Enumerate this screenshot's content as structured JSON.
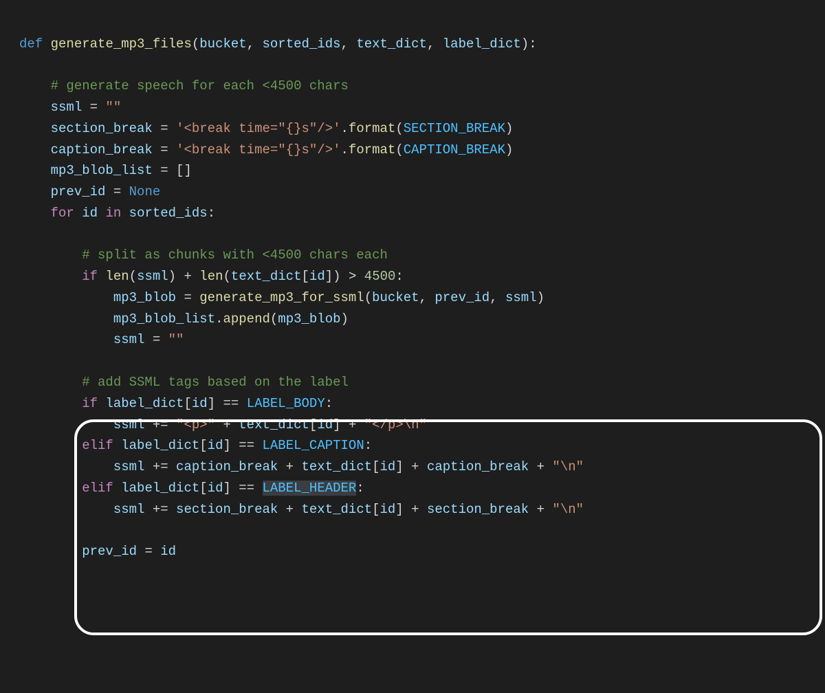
{
  "lines": {
    "l1_def": "def",
    "l1_fn": "generate_mp3_files",
    "l1_p1": "bucket",
    "l1_p2": "sorted_ids",
    "l1_p3": "text_dict",
    "l1_p4": "label_dict",
    "l3_comment": "# generate speech for each <4500 chars",
    "l4_var": "ssml",
    "l4_eq": " = ",
    "l4_str": "\"\"",
    "l5_var": "section_break",
    "l5_eq": " = ",
    "l5_str": "'<break time=\"{}s\"/>'",
    "l5_dot": ".",
    "l5_fmt": "format",
    "l5_arg": "SECTION_BREAK",
    "l6_var": "caption_break",
    "l6_eq": " = ",
    "l6_str": "'<break time=\"{}s\"/>'",
    "l6_dot": ".",
    "l6_fmt": "format",
    "l6_arg": "CAPTION_BREAK",
    "l7_var": "mp3_blob_list",
    "l7_eq": " = []",
    "l8_var": "prev_id",
    "l8_eq": " = ",
    "l8_none": "None",
    "l9_for": "for",
    "l9_id": "id",
    "l9_in": "in",
    "l9_sorted": "sorted_ids",
    "l11_comment": "# split as chunks with <4500 chars each",
    "l12_if": "if",
    "l12_len1": "len",
    "l12_ssml": "ssml",
    "l12_plus": " + ",
    "l12_len2": "len",
    "l12_td": "text_dict",
    "l12_id": "id",
    "l12_gt": " > ",
    "l12_num": "4500",
    "l13_var": "mp3_blob",
    "l13_eq": " = ",
    "l13_fn": "generate_mp3_for_ssml",
    "l13_a1": "bucket",
    "l13_a2": "prev_id",
    "l13_a3": "ssml",
    "l14_obj": "mp3_blob_list",
    "l14_dot": ".",
    "l14_app": "append",
    "l14_arg": "mp3_blob",
    "l15_var": "ssml",
    "l15_eq": " = ",
    "l15_str": "\"\"",
    "l17_comment": "# add SSML tags based on the label",
    "l18_if": "if",
    "l18_ld": "label_dict",
    "l18_id": "id",
    "l18_eqeq": " == ",
    "l18_lbl": "LABEL_BODY",
    "l19_ssml": "ssml",
    "l19_pluseq": " += ",
    "l19_s1": "\"<p>\"",
    "l19_plus1": " + ",
    "l19_td": "text_dict",
    "l19_id": "id",
    "l19_plus2": " + ",
    "l19_s2": "\"</p>\\n\"",
    "l20_elif": "elif",
    "l20_ld": "label_dict",
    "l20_id": "id",
    "l20_eqeq": " == ",
    "l20_lbl": "LABEL_CAPTION",
    "l21_ssml": "ssml",
    "l21_pluseq": " += ",
    "l21_cb1": "caption_break",
    "l21_plus1": " + ",
    "l21_td": "text_dict",
    "l21_id": "id",
    "l21_plus2": " + ",
    "l21_cb2": "caption_break",
    "l21_plus3": " + ",
    "l21_nl": "\"\\n\"",
    "l22_elif": "elif",
    "l22_ld": "label_dict",
    "l22_id": "id",
    "l22_eqeq": " == ",
    "l22_lbl": "LABEL_HEADER",
    "l23_ssml": "ssml",
    "l23_pluseq": " += ",
    "l23_sb1": "section_break",
    "l23_plus1": " + ",
    "l23_td": "text_dict",
    "l23_id": "id",
    "l23_plus2": " + ",
    "l23_sb2": "section_break",
    "l23_plus3": " + ",
    "l23_nl": "\"\\n\"",
    "l25_var": "prev_id",
    "l25_eq": " = ",
    "l25_id": "id"
  }
}
